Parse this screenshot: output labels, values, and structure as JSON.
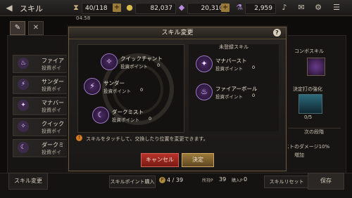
{
  "header": {
    "title": "スキル",
    "back_icon": "back-arrow-icon"
  },
  "resources": [
    {
      "value": "40/118",
      "icon": "hourglass-icon"
    },
    {
      "value": "82,037",
      "icon": "coin-icon"
    },
    {
      "value": "20,310",
      "icon": "gem-icon"
    },
    {
      "value": "2,959",
      "icon": "potion-icon"
    }
  ],
  "timer": "04:58",
  "modal": {
    "title": "スキル変更",
    "help": "?",
    "unregistered_label": "未登録スキル",
    "skills_left": [
      {
        "name": "クイックチャント",
        "label": "投資ポイント",
        "points": "0"
      },
      {
        "name": "サンダー",
        "label": "投資ポイント",
        "points": "0"
      },
      {
        "name": "ダークミスト",
        "label": "投資ポイント",
        "points": "0"
      }
    ],
    "skills_right": [
      {
        "name": "マナバースト",
        "label": "投資ポイント",
        "points": "0"
      },
      {
        "name": "ファイアーボール",
        "label": "投資ポイント",
        "points": "0"
      }
    ],
    "info": "スキルをタッチして、交換したり位置を変更できます。",
    "cancel": "キャンセル",
    "confirm": "決定"
  },
  "background": {
    "left_rows": [
      {
        "name": "ファイア",
        "sub": "投資ポイ"
      },
      {
        "name": "サンダー",
        "sub": "投資ポイ"
      },
      {
        "name": "マナバー",
        "sub": "投資ポイ"
      },
      {
        "name": "クイック",
        "sub": "投資ポイ"
      },
      {
        "name": "ダークミ",
        "sub": "投資ポイ"
      }
    ],
    "combo_label": "コンボスキル",
    "strengthen_label": "決定打の強化",
    "count": "0/5",
    "next_stage": "次の段階",
    "damage_text": "ストのダメージ10%",
    "increase": "増加"
  },
  "bottom": {
    "left_button": "スキル変更",
    "buy_points": "スキルポイント購入",
    "page": "4 / 39",
    "points_label": "所持P",
    "points_value": "39",
    "points2_label": "購入P",
    "points2_value": "0",
    "reset": "スキルリセット",
    "save": "保存"
  }
}
